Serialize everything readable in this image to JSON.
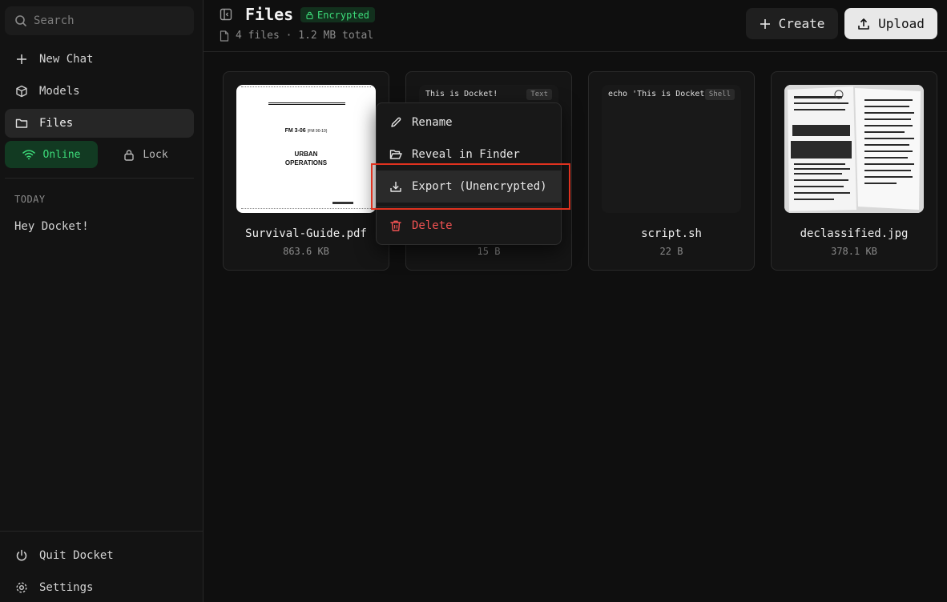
{
  "sidebar": {
    "search_placeholder": "Search",
    "nav": {
      "new_chat": "New Chat",
      "models": "Models",
      "files": "Files"
    },
    "status": {
      "online": "Online",
      "lock": "Lock"
    },
    "section_today": "TODAY",
    "chats": [
      "Hey Docket!"
    ],
    "footer": {
      "quit": "Quit Docket",
      "settings": "Settings"
    }
  },
  "header": {
    "title": "Files",
    "badge": "Encrypted",
    "meta": "4 files · 1.2 MB total",
    "create_label": "Create",
    "upload_label": "Upload"
  },
  "files": [
    {
      "name": "Survival-Guide.pdf",
      "size": "863.6 KB",
      "preview": {
        "code": "FM 3-06",
        "code_sub": "(FM 90-10)",
        "line1": "URBAN",
        "line2": "OPERATIONS"
      }
    },
    {
      "name": "",
      "size": "15 B",
      "preview_text": "This is Docket!",
      "type_tag": "Text"
    },
    {
      "name": "script.sh",
      "size": "22 B",
      "preview_text": "echo 'This is Docket!'",
      "type_tag": "Shell"
    },
    {
      "name": "declassified.jpg",
      "size": "378.1 KB"
    }
  ],
  "context_menu": {
    "rename": "Rename",
    "reveal": "Reveal in Finder",
    "export": "Export (Unencrypted)",
    "delete": "Delete"
  },
  "colors": {
    "accent_green": "#3ddc7a",
    "danger_red": "#f05252",
    "highlight_red": "#e0321f"
  }
}
